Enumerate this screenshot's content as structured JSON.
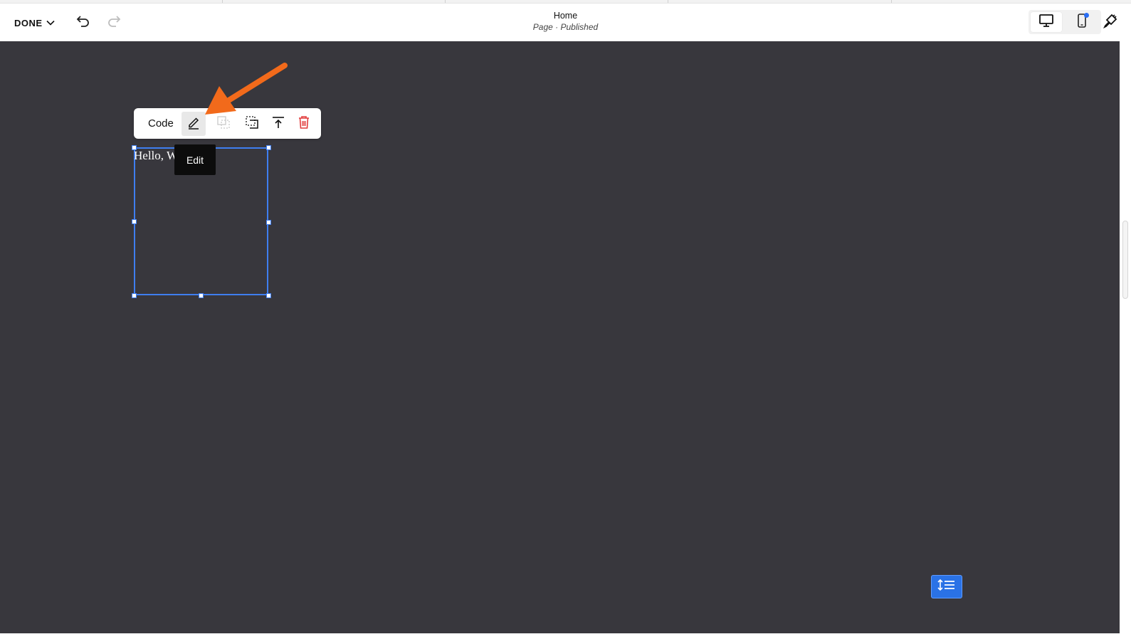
{
  "header": {
    "done_label": "DONE",
    "page_title": "Home",
    "page_subtitle": "Page · Published",
    "icons": {
      "done": "chevron-down-icon",
      "undo": "undo-icon",
      "redo": "redo-icon",
      "desktop": "desktop-icon",
      "mobile": "mobile-icon",
      "design": "paintbrush-icon"
    }
  },
  "toolbar": {
    "block_type_label": "Code",
    "icons": [
      "pencil-icon",
      "stack-icon",
      "select-icon",
      "move-to-top-icon",
      "trash-icon"
    ],
    "tooltip": "Edit"
  },
  "block": {
    "text": "Hello, World"
  },
  "colors": {
    "canvas_bg": "#38373d",
    "accent": "#3f7ef0",
    "delete": "#e23b3b",
    "annotation": "#f26a1b"
  }
}
